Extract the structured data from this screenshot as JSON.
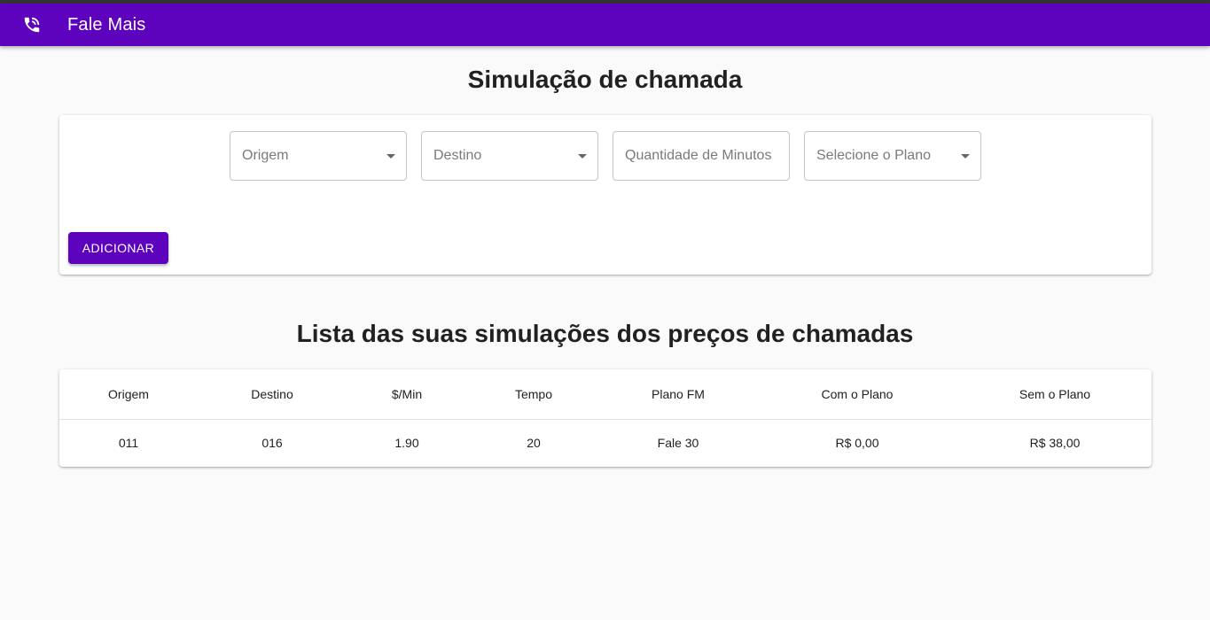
{
  "appbar": {
    "title": "Fale Mais",
    "icon": "phone-in-talk-icon"
  },
  "form": {
    "title": "Simulação de chamada",
    "origem_placeholder": "Origem",
    "destino_placeholder": "Destino",
    "minutos_placeholder": "Quantidade de Minutos",
    "plano_placeholder": "Selecione o Plano",
    "add_label": "ADICIONAR"
  },
  "list": {
    "title": "Lista das suas simulações dos preços de chamadas",
    "columns": [
      "Origem",
      "Destino",
      "$/Min",
      "Tempo",
      "Plano FM",
      "Com o Plano",
      "Sem o Plano"
    ],
    "rows": [
      [
        "011",
        "016",
        "1.90",
        "20",
        "Fale 30",
        "R$ 0,00",
        "R$ 38,00"
      ]
    ]
  },
  "colors": {
    "primary": "#5d02bd",
    "background": "#fafafa"
  }
}
